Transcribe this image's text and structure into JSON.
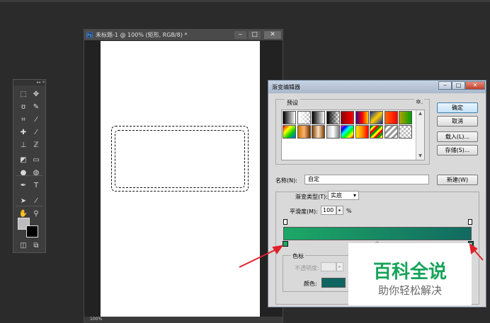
{
  "document": {
    "title": "未标题-1 @ 100% (矩形, RGB/8) *",
    "ps_icon": "Ps",
    "zoom": "100%",
    "controls": {
      "minimize": "‒",
      "maximize": "□",
      "close": "✕"
    }
  },
  "tools": {
    "header": "◂◂ ✕",
    "items": [
      {
        "icon": "marquee-icon",
        "glyph": "⬚"
      },
      {
        "icon": "move-icon",
        "glyph": "✥"
      },
      {
        "icon": "lasso-icon",
        "glyph": "ʊ"
      },
      {
        "icon": "quick-select-icon",
        "glyph": "✎"
      },
      {
        "icon": "crop-icon",
        "glyph": "⌗"
      },
      {
        "icon": "eyedropper-icon",
        "glyph": "⁄"
      },
      {
        "icon": "healing-icon",
        "glyph": "✚"
      },
      {
        "icon": "brush-icon",
        "glyph": "⁄"
      },
      {
        "icon": "stamp-icon",
        "glyph": "⊥"
      },
      {
        "icon": "history-brush-icon",
        "glyph": "ℤ"
      },
      {
        "icon": "eraser-icon",
        "glyph": "◩"
      },
      {
        "icon": "gradient-icon",
        "glyph": "▭"
      },
      {
        "icon": "blur-icon",
        "glyph": "●"
      },
      {
        "icon": "dodge-icon",
        "glyph": "◍"
      },
      {
        "icon": "pen-icon",
        "glyph": "✒"
      },
      {
        "icon": "type-icon",
        "glyph": "T"
      },
      {
        "icon": "path-select-icon",
        "glyph": "➤"
      },
      {
        "icon": "line-icon",
        "glyph": "⁄"
      },
      {
        "icon": "hand-icon",
        "glyph": "✋"
      },
      {
        "icon": "zoom-icon",
        "glyph": "⚲"
      }
    ],
    "quick_mask_glyph": "◫",
    "screen_mode_glyph": "⧉"
  },
  "dialog": {
    "title": "渐变编辑器",
    "controls": {
      "minimize": "‒",
      "maximize": "□",
      "close": "✕"
    },
    "presets_label": "预设",
    "presets_gear": "✲.",
    "presets_swatches": [
      "linear-gradient(90deg,#000,#fff)",
      "linear-gradient(90deg,#fff,rgba(255,255,255,0)),repeating-conic-gradient(#bbb 0 25%,#fff 0 50%) 0 0/6px 6px",
      "linear-gradient(90deg,#000,#fff)",
      "linear-gradient(90deg,#000,rgba(0,0,0,0)),repeating-conic-gradient(#bbb 0 25%,#fff 0 50%) 0 0/6px 6px",
      "linear-gradient(90deg,#8b0000,#ff0000)",
      "linear-gradient(90deg,#3b0b8a,#ff0000,#ffd000)",
      "linear-gradient(135deg,#0a2a9a,#ffcc00,#0a2a9a)",
      "linear-gradient(90deg,#ff6600,#ff0000)",
      "linear-gradient(90deg,#b8a000,#00a000)",
      "linear-gradient(135deg,#ff0000,#ffff00,#00cc00,#0066ff)",
      "linear-gradient(90deg,#cc7a00,#ffb070,#663300)",
      "linear-gradient(90deg,#7b3f00,#ffe0c0,#7b3f00)",
      "linear-gradient(90deg,#c0c0c0,#ffffff,#808080)",
      "linear-gradient(135deg,#ff00ff,#0000ff,#00ffff,#00ff00,#ffff00,#ff0000)",
      "linear-gradient(90deg,#ffee00,#ff8800,#ff0000)",
      "repeating-linear-gradient(135deg,#00a000 0 3px,#ffee00 3px 6px,#ff0000 6px 9px)",
      "repeating-linear-gradient(135deg,#999 0 3px,#fff 3px 6px)",
      "repeating-conic-gradient(#bbb 0 25%,#fff 0 50%) 0 0/6px 6px"
    ],
    "buttons": {
      "ok": "确定",
      "cancel": "取消",
      "load": "载入(L)...",
      "save": "存储(S)...",
      "new": "新建(W)"
    },
    "name_label": "名称(N):",
    "name_value": "自定",
    "gradient_type_label": "渐变类型(T):",
    "gradient_type_value": "实底",
    "smoothness_label": "平滑度(M):",
    "smoothness_value": "100",
    "smoothness_unit": "%",
    "stop_color_start": "#1da866",
    "stop_color_end": "#116a60",
    "stops_label": "色标",
    "opacity_label": "不透明度:",
    "color_label": "颜色:",
    "color_value": "#0f6660",
    "dropdown_glyph": "▾",
    "spinner_glyph": "▸",
    "midpoint_glyph": "◇"
  },
  "watermark": {
    "main": "百科全说",
    "sub": "助你轻松解决"
  }
}
